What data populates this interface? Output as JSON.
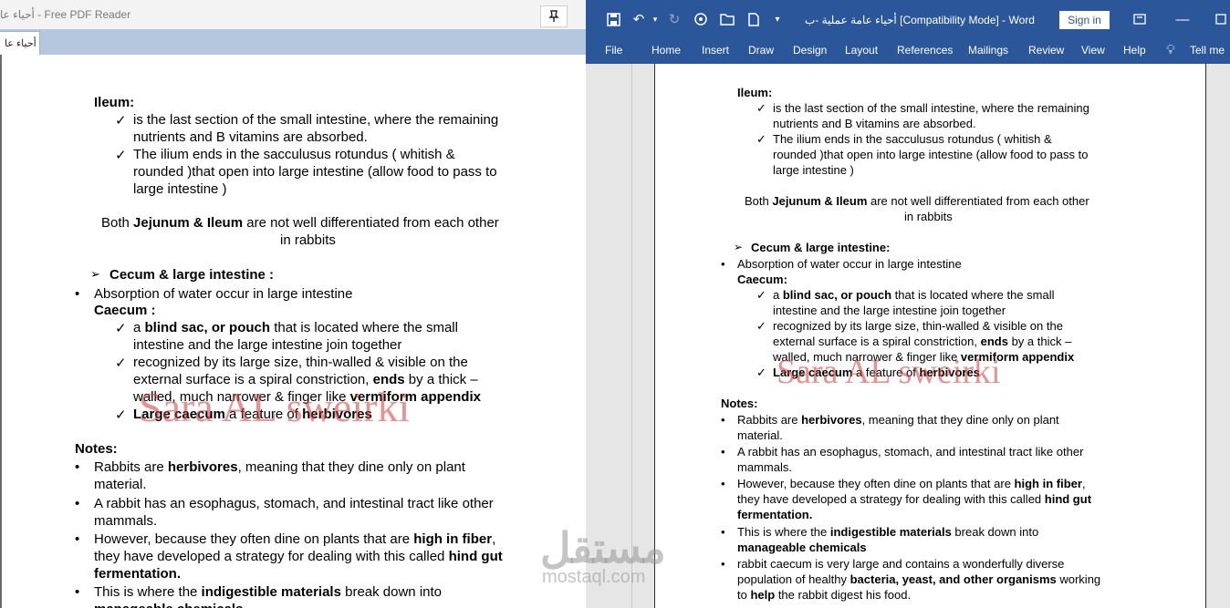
{
  "pdf_reader": {
    "window_title": "أحياء عا - Free PDF Reader",
    "tab_label": "أحياء عا"
  },
  "word": {
    "doc_title": "أحياء عامة عملية -ب [Compatibility Mode]  -  Word",
    "sign_in": "Sign in",
    "tabs": [
      "File",
      "Home",
      "Insert",
      "Draw",
      "Design",
      "Layout",
      "References",
      "Mailings",
      "Review",
      "View",
      "Help",
      "Tell me"
    ]
  },
  "document": {
    "ileum_heading": "Ileum:",
    "ileum_1_a": "is the last section of the small intestine, where the remaining",
    "ileum_1_b": "nutrients and B vitamins are absorbed.",
    "ileum_2_a": "The ilium ends in the sacculusus rotundus ( whitish &",
    "ileum_2_b": "rounded )that open into large intestine (allow food to pass to",
    "ileum_2_c": "large intestine )",
    "both_pre": "Both ",
    "both_bold": "Jejunum & Ileum",
    "both_post": " are not well differentiated from each other",
    "both_2": "in rabbits",
    "cecum_heading_pdf": "Cecum & large intestine :",
    "cecum_heading_word": "Cecum & large intestine:",
    "absorption": "Absorption of water occur in large intestine",
    "caecum_heading_pdf": "Caecum :",
    "caecum_heading_word": "Caecum:",
    "c1_pre": "a ",
    "c1_bold": "blind sac, or pouch",
    "c1_post": " that is located where the small",
    "c1_b": "intestine and the large intestine join together",
    "c2_a": "recognized by its large size, thin-walled & visible on the",
    "c2_b_pre": "external surface is a spiral constriction, ",
    "c2_b_bold": "ends",
    "c2_b_post": " by a thick –",
    "c2_c_pre": "walled, much narrower & finger like ",
    "c2_c_bold": "vermiform appendix",
    "c3_bold": "Large caecum",
    "c3_mid": " a feature of ",
    "c3_bold2": "herbivores",
    "notes_heading": "Notes:",
    "n1_pre": "Rabbits are ",
    "n1_bold": "herbivores",
    "n1_post": ", meaning that they dine only on plant",
    "n1_b": "material.",
    "n2_a": "A rabbit has an esophagus, stomach, and intestinal tract like other",
    "n2_b": "mammals.",
    "n3_pre": "However, because they often dine on plants that are ",
    "n3_bold": "high in fiber",
    "n3_b_pre": "they have developed a strategy for dealing with this called ",
    "n3_b_bold": "hind gut",
    "n3_c_bold": "fermentation.",
    "n4_pre": "This is where the ",
    "n4_bold": "indigestible materials",
    "n4_post": " break down into",
    "n4_b_bold": "manageable chemicals",
    "n5_a": "rabbit caecum is very large and contains a wonderfully diverse",
    "n5_b_pre": "population of healthy ",
    "n5_b_bold": "bacteria, yeast, and other organisms",
    "n5_b_post": " working",
    "n5_c_pre": "to ",
    "n5_c_bold": "help",
    "n5_c_post": " the rabbit digest his food.",
    "watermark": "Sara AL sweirki"
  },
  "site_watermark": {
    "arabic": "مستقل",
    "latin": "mostaql.com"
  }
}
